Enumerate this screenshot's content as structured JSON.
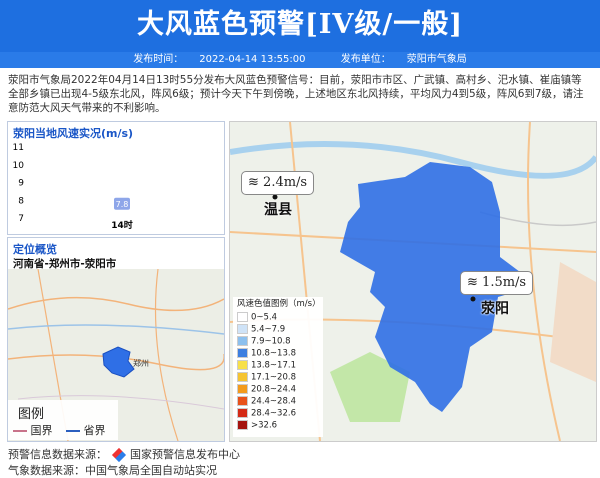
{
  "header": {
    "title": "大风蓝色预警[IV级/一般]"
  },
  "subbar": {
    "time_label": "发布时间：",
    "time": "2022-04-14 13:55:00",
    "unit_label": "发布单位：",
    "unit": "荥阳市气象局"
  },
  "description": "荥阳市气象局2022年04月14日13时55分发布大风蓝色预警信号：目前，荥阳市市区、广武镇、高村乡、汜水镇、崔庙镇等全部乡镇已出现4-5级东北风，阵风6级；预计今天下午到傍晚，上述地区东北风持续，平均风力4到5级，阵风6到7级，请注意防范大风天气带来的不利影响。",
  "wind_panel": {
    "title": "荥阳当地风速实况(m/s)",
    "chart_data": {
      "type": "bar",
      "categories": [
        "14时"
      ],
      "values": [
        7.8
      ],
      "yticks": [
        11,
        10,
        9,
        8,
        7
      ],
      "ylim": [
        7,
        11
      ]
    }
  },
  "location_panel": {
    "title": "定位概览",
    "region": "河南省-郑州市-荥阳市",
    "map_label": "郑州",
    "legend": {
      "title": "图例",
      "national": "国界",
      "provincial": "省界"
    }
  },
  "map": {
    "tags": [
      {
        "speed": "2.4m/s",
        "city": "温县"
      },
      {
        "speed": "1.5m/s",
        "city": "荥阳"
      }
    ],
    "legend": {
      "title": "风速色值图例（m/s）",
      "items": [
        {
          "range": "0~5.4",
          "color": "#ffffff"
        },
        {
          "range": "5.4~7.9",
          "color": "#cfe3f7"
        },
        {
          "range": "7.9~10.8",
          "color": "#8cc0ee"
        },
        {
          "range": "10.8~13.8",
          "color": "#3d7fe0"
        },
        {
          "range": "13.8~17.1",
          "color": "#f7e04a"
        },
        {
          "range": "17.1~20.8",
          "color": "#f5c431"
        },
        {
          "range": "20.8~24.4",
          "color": "#f39b1c"
        },
        {
          "range": "24.4~28.4",
          "color": "#e8521a"
        },
        {
          "range": "28.4~32.6",
          "color": "#d42a15"
        },
        {
          "range": ">32.6",
          "color": "#a5140f"
        }
      ]
    }
  },
  "footer": {
    "line1_label": "预警信息数据来源：",
    "line1_value": "国家预警信息发布中心",
    "line2": "气象数据来源：中国气象局全国自动站实况"
  }
}
